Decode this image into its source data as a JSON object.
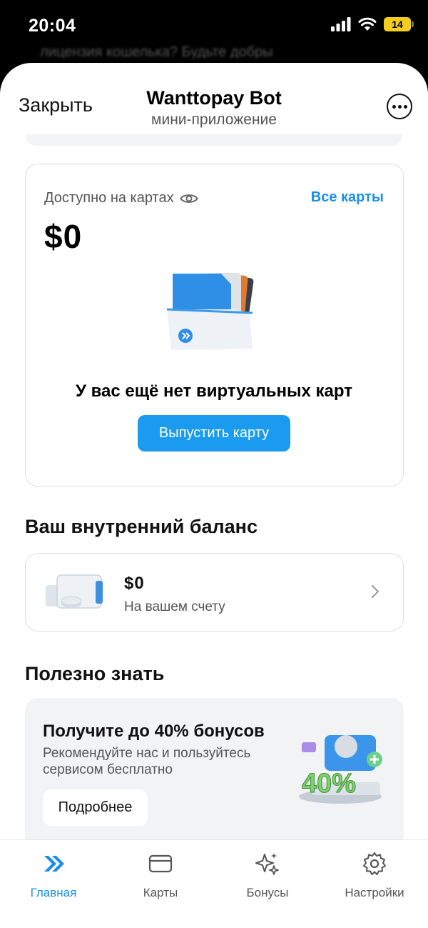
{
  "status_bar": {
    "time": "20:04",
    "battery": "14"
  },
  "background_text": "лицензия кошелька? Будьте добры",
  "header": {
    "close_label": "Закрыть",
    "title": "Wanttopay Bot",
    "subtitle": "мини-приложение"
  },
  "cards_block": {
    "available_label": "Доступно на картах",
    "all_cards_link": "Все карты",
    "balance": "$0",
    "empty_message": "У вас ещё нет виртуальных карт",
    "issue_button": "Выпустить карту"
  },
  "internal_balance": {
    "section_title": "Ваш внутренний баланс",
    "amount": "$0",
    "subtitle": "На вашем счету"
  },
  "useful": {
    "section_title": "Полезно знать",
    "promo_title": "Получите до 40% бонусов",
    "promo_text": "Рекомендуйте нас и пользуйтесь сервисом бесплатно",
    "promo_button": "Подробнее",
    "promo_badge": "40%"
  },
  "nav": {
    "items": [
      {
        "label": "Главная",
        "icon": "double-chevron-icon",
        "active": true
      },
      {
        "label": "Карты",
        "icon": "card-icon",
        "active": false
      },
      {
        "label": "Бонусы",
        "icon": "sparkles-icon",
        "active": false
      },
      {
        "label": "Настройки",
        "icon": "gear-icon",
        "active": false
      }
    ]
  },
  "colors": {
    "accent": "#1a9bef",
    "link": "#1a8fe8",
    "border": "#dcdfe3",
    "promo_bg": "#f2f3f5"
  }
}
